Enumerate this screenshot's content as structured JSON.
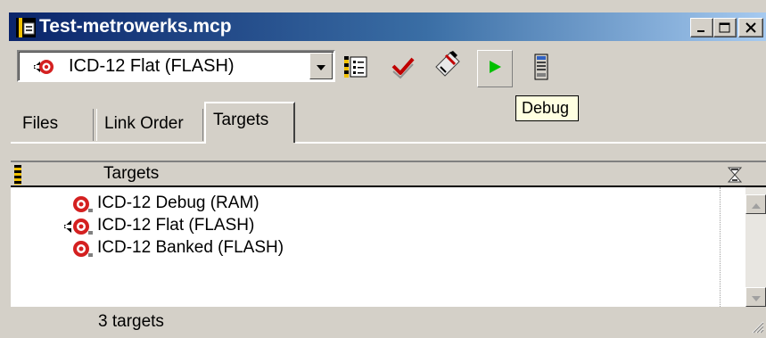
{
  "window": {
    "title": "Test-metrowerks.mcp",
    "title_icon": "project-icon",
    "controls": {
      "minimize_label": "_",
      "maximize_icon": "maximize-icon",
      "close_label": "✕"
    }
  },
  "toolbar": {
    "current_target": "ICD-12 Flat (FLASH)",
    "target_icon": "target-icon",
    "buttons": [
      "settings-icon",
      "synchronize-icon",
      "make-icon",
      "debug-icon",
      "run-icon"
    ],
    "tooltip": "Debug",
    "accent": "#00c000"
  },
  "tabs": [
    {
      "label": "Files",
      "active": false
    },
    {
      "label": "Link Order",
      "active": false
    },
    {
      "label": "Targets",
      "active": true
    }
  ],
  "targets_panel": {
    "header": "Targets",
    "rows": [
      {
        "label": "ICD-12 Debug (RAM)",
        "current": false
      },
      {
        "label": "ICD-12 Flat (FLASH)",
        "current": true
      },
      {
        "label": "ICD-12 Banked (FLASH)",
        "current": false
      }
    ],
    "status": "3 targets"
  },
  "colors": {
    "titlebar_start": "#0a246a",
    "titlebar_end": "#a6caf0",
    "face": "#d4d0c8",
    "target_red": "#d42020",
    "tooltip_bg": "#ffffe1"
  }
}
